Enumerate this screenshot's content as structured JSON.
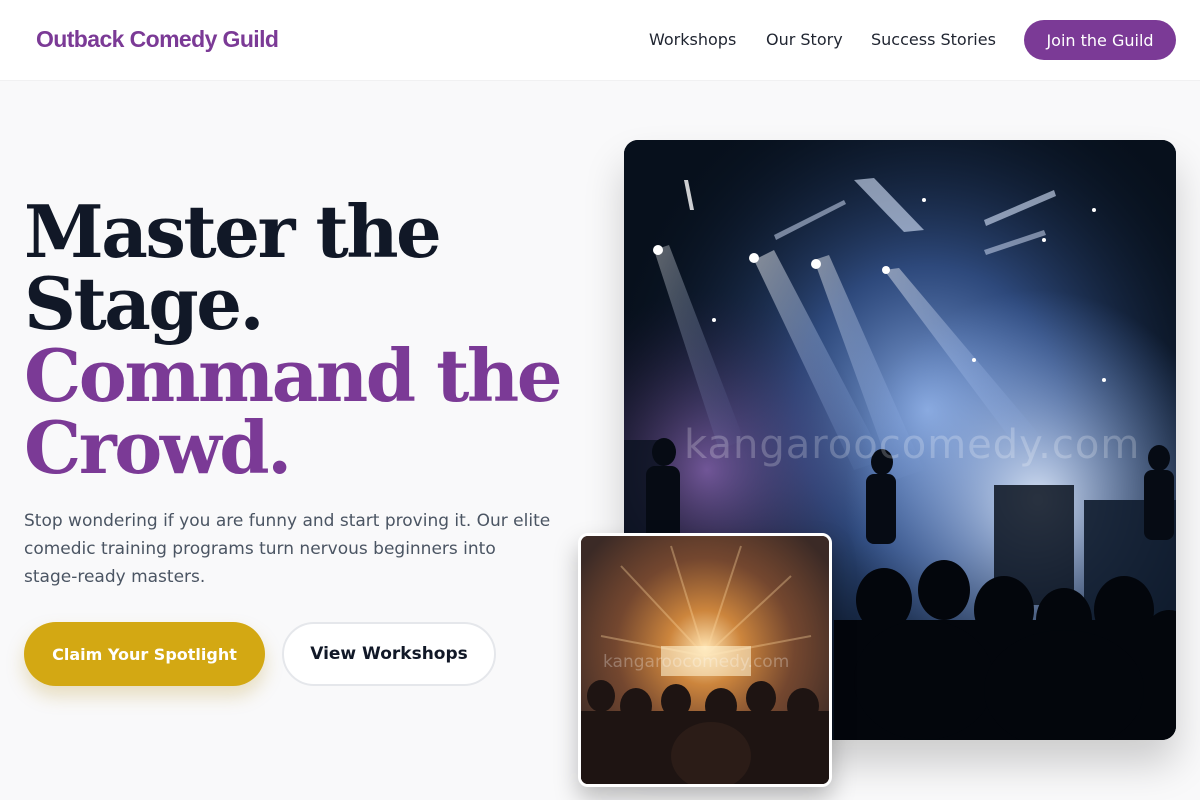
{
  "header": {
    "brand": "Outback Comedy Guild",
    "nav": [
      "Workshops",
      "Our Story",
      "Success Stories"
    ],
    "cta": "Join the Guild"
  },
  "hero": {
    "headline_line1": "Master the",
    "headline_line2": "Stage.",
    "headline_line3": "Command the",
    "headline_line4": "Crowd.",
    "subtext": "Stop wondering if you are funny and start proving it. Our elite comedic training programs turn nervous beginners into stage-ready masters.",
    "primary_cta": "Claim Your Spotlight",
    "secondary_cta": "View Workshops"
  },
  "images": {
    "main_watermark": "kangaroocomedy.com",
    "small_watermark": "kangaroocomedy.com"
  },
  "colors": {
    "brand_purple": "#7b3a96",
    "accent_gold": "#d3a813",
    "heading_dark": "#111827",
    "background": "#f9f9fa"
  }
}
